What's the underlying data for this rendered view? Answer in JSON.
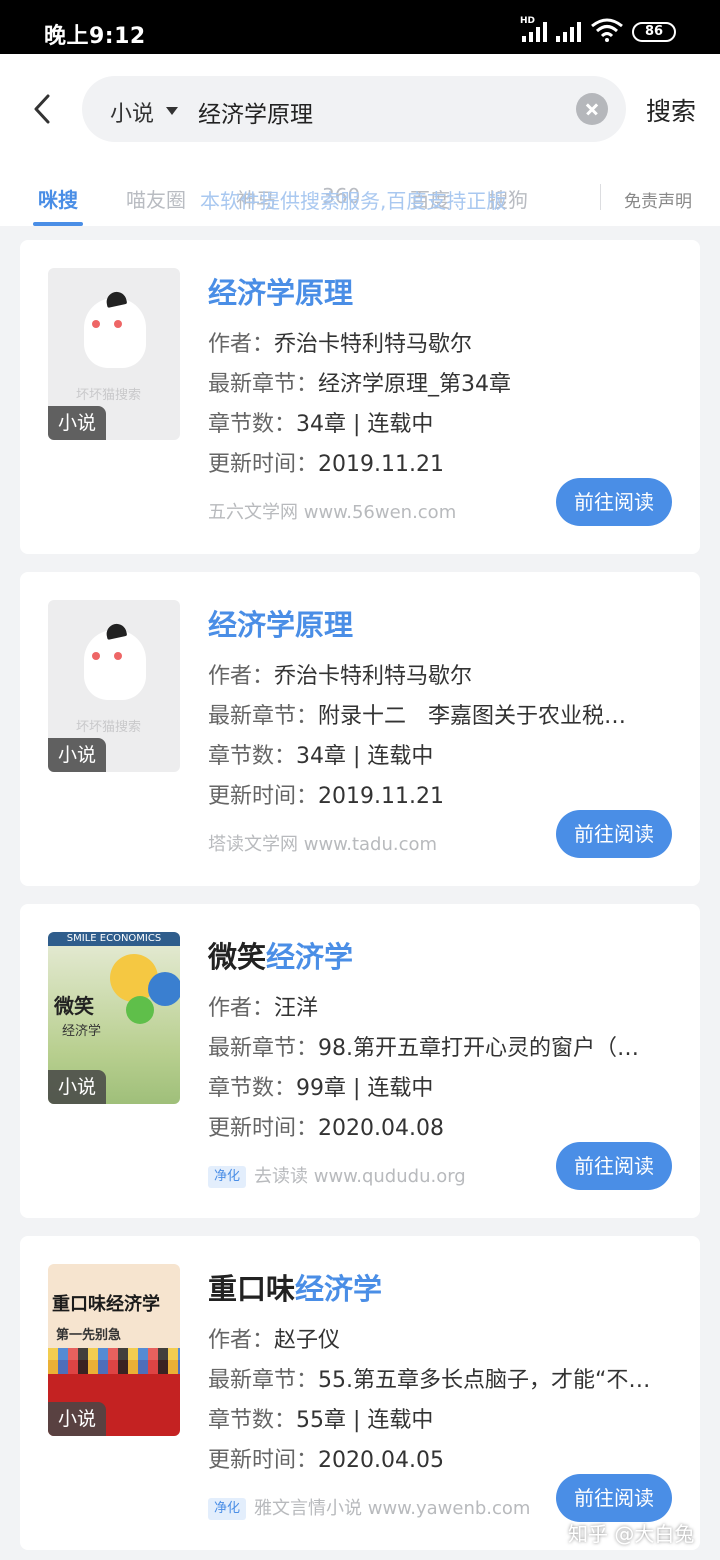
{
  "status_bar": {
    "time": "晚上9:12",
    "network": "HD",
    "battery": "86"
  },
  "header": {
    "category": "小说",
    "query": "经济学原理",
    "search_button": "搜索"
  },
  "tabs": {
    "items": [
      "咪搜",
      "喵友圈",
      "神马",
      "360",
      "百度",
      "搜狗"
    ],
    "overlay_notice": "本软件提供搜索服务,百度支持正版",
    "disclaimer": "免责声明"
  },
  "labels": {
    "author": "作者：",
    "latest": "最新章节：",
    "chapters": "章节数：",
    "updated": "更新时间：",
    "read": "前往阅读",
    "purify": "净化",
    "cover_tag": "小说",
    "cover_watermark": "坏坏猫搜索"
  },
  "results": [
    {
      "title_plain": "",
      "title_highlight": "经济学原理",
      "author": "乔治卡特利特马歇尔",
      "latest": "经济学原理_第34章",
      "chapters": "34章 | 连载中",
      "updated": "2019.11.21",
      "purified": false,
      "source": "五六文学网 www.56wen.com"
    },
    {
      "title_plain": "",
      "title_highlight": "经济学原理",
      "author": "乔治卡特利特马歇尔",
      "latest": "附录十二　李嘉图关于农业税…",
      "chapters": "34章 | 连载中",
      "updated": "2019.11.21",
      "purified": false,
      "source": "塔读文学网 www.tadu.com"
    },
    {
      "title_plain": "微笑",
      "title_highlight": "经济学",
      "author": "汪洋",
      "latest": "98.第开五章打开心灵的窗户（…",
      "chapters": "99章 | 连载中",
      "updated": "2020.04.08",
      "purified": true,
      "source": "去读读 www.qududu.org",
      "cover": {
        "top": "SMILE ECONOMICS",
        "title": "微笑",
        "sub": "经济学"
      }
    },
    {
      "title_plain": "重口味",
      "title_highlight": "经济学",
      "author": "赵子仪",
      "latest": "55.第五章多长点脑子，才能“不…",
      "chapters": "55章 | 连载中",
      "updated": "2020.04.05",
      "purified": true,
      "source": "雅文言情小说 www.yawenb.com",
      "cover": {
        "title": "重口味经济学",
        "mid": "第一先别急"
      }
    }
  ],
  "watermark": "知乎 @大白兔",
  "colors": {
    "accent": "#4a8ee6",
    "status_bar": "#000000",
    "page_bg": "#f2f3f5"
  }
}
